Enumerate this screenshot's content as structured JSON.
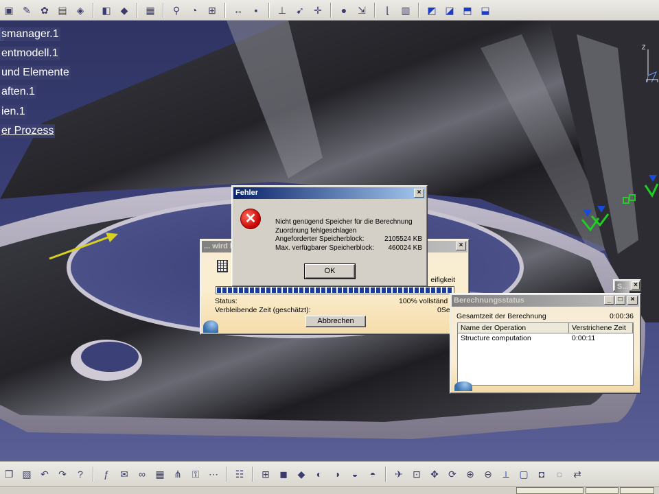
{
  "spec_tree": {
    "items": [
      {
        "label": "smanager.1",
        "link": false
      },
      {
        "label": "entmodell.1",
        "link": false
      },
      {
        "label": "und Elemente",
        "link": false
      },
      {
        "label": "aften.1",
        "link": false
      },
      {
        "label": "ien.1",
        "link": false
      },
      {
        "label": "er Prozess",
        "link": true
      }
    ]
  },
  "error_dialog": {
    "title": "Fehler",
    "close_label": "×",
    "line1": "Nicht genügend Speicher für die Berechnung",
    "line2": "Zuordnung fehlgeschlagen",
    "requested_label": "Angeforderter Speicherblock:",
    "requested_value": "2105524 KB",
    "available_label": "Max. verfügbarer Speicherblock:",
    "available_value": "460024 KB",
    "ok_label": "OK"
  },
  "progress_window": {
    "title": "... wird b",
    "close_label": "×",
    "genauigkeit_label": "eifigkeit",
    "status_label": "Status:",
    "status_value": "100% vollständ",
    "remaining_label": "Verbleibende Zeit (geschätzt):",
    "remaining_value": "0Se",
    "cancel_label": "Abbrechen",
    "progress_fraction": 1.0
  },
  "mini_window": {
    "title": "S...",
    "close_label": "×"
  },
  "calc_status": {
    "title": "Berechnungsstatus",
    "total_label": "Gesamtzeit der Berechnung",
    "total_value": "0:00:36",
    "columns": [
      "Name der Operation",
      "Verstrichene Zeit"
    ],
    "rows": [
      {
        "operation": "Structure computation",
        "time": "0:00:11"
      }
    ],
    "min_label": "_",
    "max_label": "□",
    "close_label": "×"
  },
  "viewport": {
    "compass_label": "Z",
    "colors": {
      "background": "#3b4077",
      "part": "#2a2a30",
      "arrow": "#d8d020",
      "constraint": "#22cc22"
    }
  },
  "toolbar_top": {
    "icons": [
      "product-icon",
      "sketch-icon",
      "snap-icon",
      "color-icon",
      "analysis-icon",
      "sep",
      "material-icon",
      "surface-icon",
      "sep",
      "table-icon",
      "sep",
      "clamp-icon",
      "user-material-icon",
      "mesh-icon",
      "sep",
      "measure-icon",
      "save-icon",
      "sep",
      "restraint-icon",
      "load-icon",
      "axis-icon",
      "sep",
      "mass-icon",
      "force-icon",
      "sep",
      "sensor-icon",
      "image-icon",
      "sep",
      "view-iso-icon",
      "view-front-icon",
      "view-top-icon",
      "view-right-icon"
    ]
  },
  "toolbar_bottom": {
    "icons": [
      "copy-icon",
      "paste-icon",
      "undo-icon",
      "redo-icon",
      "help-icon",
      "sep",
      "formula-icon",
      "comment-icon",
      "link-icon",
      "table-icon",
      "tree-icon",
      "lock-icon",
      "macro-icon",
      "sep",
      "spec-tree-icon",
      "sep",
      "mesh-icon",
      "part-icon",
      "surface-icon",
      "fill-icon",
      "fill2-icon",
      "fill3-icon",
      "fill4-icon",
      "sep",
      "fly-icon",
      "fit-icon",
      "pan-icon",
      "rotate-icon",
      "zoom-in-icon",
      "zoom-out-icon",
      "normal-view-icon",
      "views-icon",
      "render-icon",
      "hide-icon",
      "swap-icon"
    ]
  }
}
